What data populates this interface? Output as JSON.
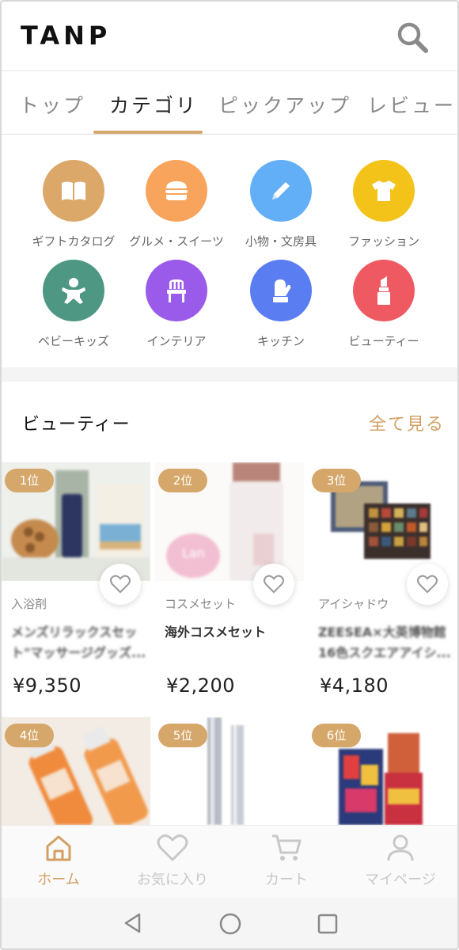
{
  "header": {
    "logo": "TANP",
    "search_icon": "search-icon"
  },
  "tabs": [
    {
      "label": "トップ",
      "active": false
    },
    {
      "label": "カテゴリ",
      "active": true
    },
    {
      "label": "ピックアップ",
      "active": false
    },
    {
      "label": "レビュー",
      "active": false
    }
  ],
  "categories": [
    {
      "label": "ギフトカタログ",
      "icon": "book-icon",
      "color": "#dba86a"
    },
    {
      "label": "グルメ・スイーツ",
      "icon": "burger-icon",
      "color": "#f9a45c"
    },
    {
      "label": "小物・文房具",
      "icon": "pencil-icon",
      "color": "#62aef7"
    },
    {
      "label": "ファッション",
      "icon": "tshirt-icon",
      "color": "#f3c31a"
    },
    {
      "label": "ベビーキッズ",
      "icon": "baby-icon",
      "color": "#4e9782"
    },
    {
      "label": "インテリア",
      "icon": "chair-icon",
      "color": "#9b5bea"
    },
    {
      "label": "キッチン",
      "icon": "mitten-icon",
      "color": "#5b7df2"
    },
    {
      "label": "ビューティー",
      "icon": "lipstick-icon",
      "color": "#ef5a62"
    }
  ],
  "section": {
    "title": "ビューティー",
    "see_all": "全て見る"
  },
  "products": [
    {
      "rank": "1位",
      "category": "入浴剤",
      "name": "メンズリラックスセット\"マッサージグッズ...",
      "price": "¥9,350"
    },
    {
      "rank": "2位",
      "category": "コスメセット",
      "name": "海外コスメセット",
      "price": "¥2,200"
    },
    {
      "rank": "3位",
      "category": "アイシャドウ",
      "name": "ZEESEA×大英博物館 16色スクエアアイシ...",
      "price": "¥4,180"
    },
    {
      "rank": "4位"
    },
    {
      "rank": "5位"
    },
    {
      "rank": "6位"
    }
  ],
  "bottom_nav": [
    {
      "label": "ホーム",
      "icon": "home-icon",
      "active": true
    },
    {
      "label": "お気に入り",
      "icon": "heart-icon",
      "active": false
    },
    {
      "label": "カート",
      "icon": "cart-icon",
      "active": false
    },
    {
      "label": "マイページ",
      "icon": "user-icon",
      "active": false
    }
  ],
  "system_nav": {
    "back_icon": "back-triangle-icon",
    "home_icon": "home-circle-icon",
    "recents_icon": "recents-square-icon"
  },
  "colors": {
    "accent": "#d2a063",
    "rank_badge": "#d5a76a"
  }
}
